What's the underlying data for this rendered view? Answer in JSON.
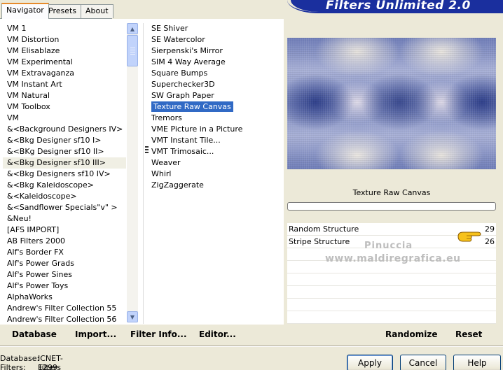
{
  "tabs": [
    "Navigator",
    "Presets",
    "About"
  ],
  "app_title": "Filters Unlimited 2.0",
  "categories": [
    "VM 1",
    "VM Distortion",
    "VM Elisablaze",
    "VM Experimental",
    "VM Extravaganza",
    "VM Instant Art",
    "VM Natural",
    "VM Toolbox",
    "VM",
    "&<Background Designers IV>",
    "&<Bkg Designer sf10 I>",
    "&<BKg Designer sf10 II>",
    "&<Bkg Designer sf10 III>",
    "&<Bkg Designers sf10 IV>",
    "&<Bkg Kaleidoscope>",
    "&<Kaleidoscope>",
    "&<Sandflower Specials\"v\" >",
    "&Neu!",
    "[AFS IMPORT]",
    "AB Filters 2000",
    "Alf's Border FX",
    "Alf's Power Grads",
    "Alf's Power Sines",
    "Alf's Power Toys",
    "AlphaWorks",
    "Andrew's Filter Collection 55",
    "Andrew's Filter Collection 56"
  ],
  "highlighted_category": "&<Bkg Designer sf10 III>",
  "filters": [
    "SE Shiver",
    "SE Watercolor",
    "Sierpenski's Mirror",
    "SIM 4 Way Average",
    "Square Bumps",
    "Superchecker3D",
    "SW Graph Paper",
    "Texture Raw Canvas",
    "Tremors",
    "VME Picture in a Picture",
    "VMT Instant Tile...",
    "VMT Trimosaic...",
    "Weaver",
    "Whirl",
    "ZigZaggerate"
  ],
  "selected_filter": "Texture Raw Canvas",
  "preview_filter_name": "Texture Raw Canvas",
  "parameters": [
    {
      "label": "Random Structure",
      "value": "29"
    },
    {
      "label": "Stripe Structure",
      "value": "26"
    }
  ],
  "watermark": {
    "line1": "Pinuccia",
    "line2": "www.maldiregrafica.eu"
  },
  "toolbar": {
    "database": "Database",
    "import": "Import...",
    "filter_info": "Filter Info...",
    "editor": "Editor...",
    "randomize": "Randomize",
    "reset": "Reset"
  },
  "status": {
    "database_label": "Database:",
    "database_value": "ICNET-Filters",
    "filters_label": "Filters:",
    "filters_value": "1299"
  },
  "buttons": {
    "apply": "Apply",
    "cancel": "Cancel",
    "help": "Help"
  },
  "colors": {
    "selection": "#316ac5",
    "banner": "#1a2f9e",
    "window_bg": "#ece9d8"
  }
}
